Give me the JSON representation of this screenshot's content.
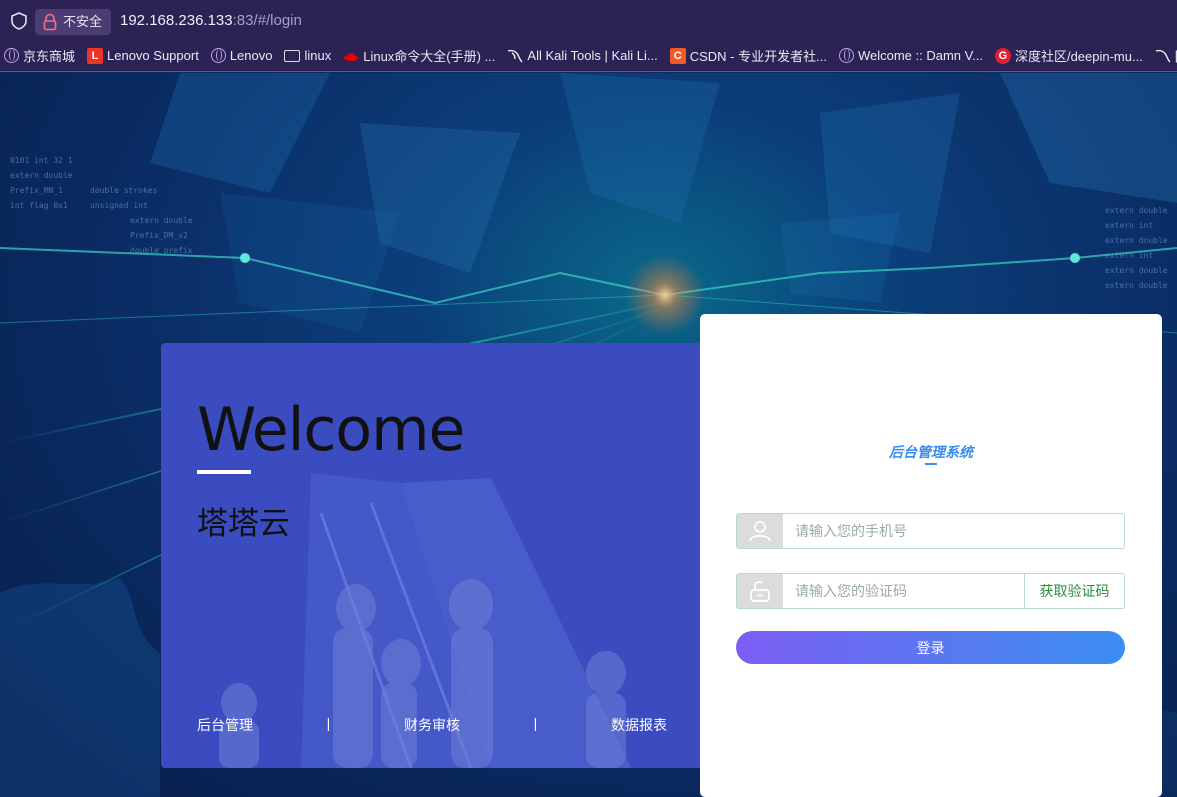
{
  "browser": {
    "security_label": "不安全",
    "url_host": "192.168.236.133",
    "url_rest": ":83/#/login",
    "bookmarks": [
      {
        "label": "京东商城",
        "icon": "globe-icon"
      },
      {
        "label": "Lenovo Support",
        "icon": "lenovo-l-icon"
      },
      {
        "label": "Lenovo",
        "icon": "globe-icon"
      },
      {
        "label": "linux",
        "icon": "folder-icon"
      },
      {
        "label": "Linux命令大全(手册) ...",
        "icon": "redhat-icon"
      },
      {
        "label": "All Kali Tools | Kali Li...",
        "icon": "kali-dragon-icon"
      },
      {
        "label": "CSDN - 专业开发者社...",
        "icon": "csdn-c-icon"
      },
      {
        "label": "Welcome :: Damn V...",
        "icon": "globe-icon"
      },
      {
        "label": "深度社区/deepin-mu...",
        "icon": "gitee-g-icon"
      },
      {
        "label": "[",
        "icon": "kali-dragon-icon"
      }
    ]
  },
  "welcome": {
    "title": "Welcome",
    "subtitle": "塔塔云",
    "tags": [
      "后台管理",
      "|",
      "财务审核",
      "|",
      "数据报表"
    ]
  },
  "login": {
    "brand": "后台管理系统",
    "phone_placeholder": "请输入您的手机号",
    "code_placeholder": "请输入您的验证码",
    "get_code_label": "获取验证码",
    "submit_label": "登录"
  },
  "colors": {
    "accent_start": "#7b5ef2",
    "accent_end": "#3b8ef3",
    "brand": "#3a8ef0",
    "panel": "#3a4cc0"
  }
}
